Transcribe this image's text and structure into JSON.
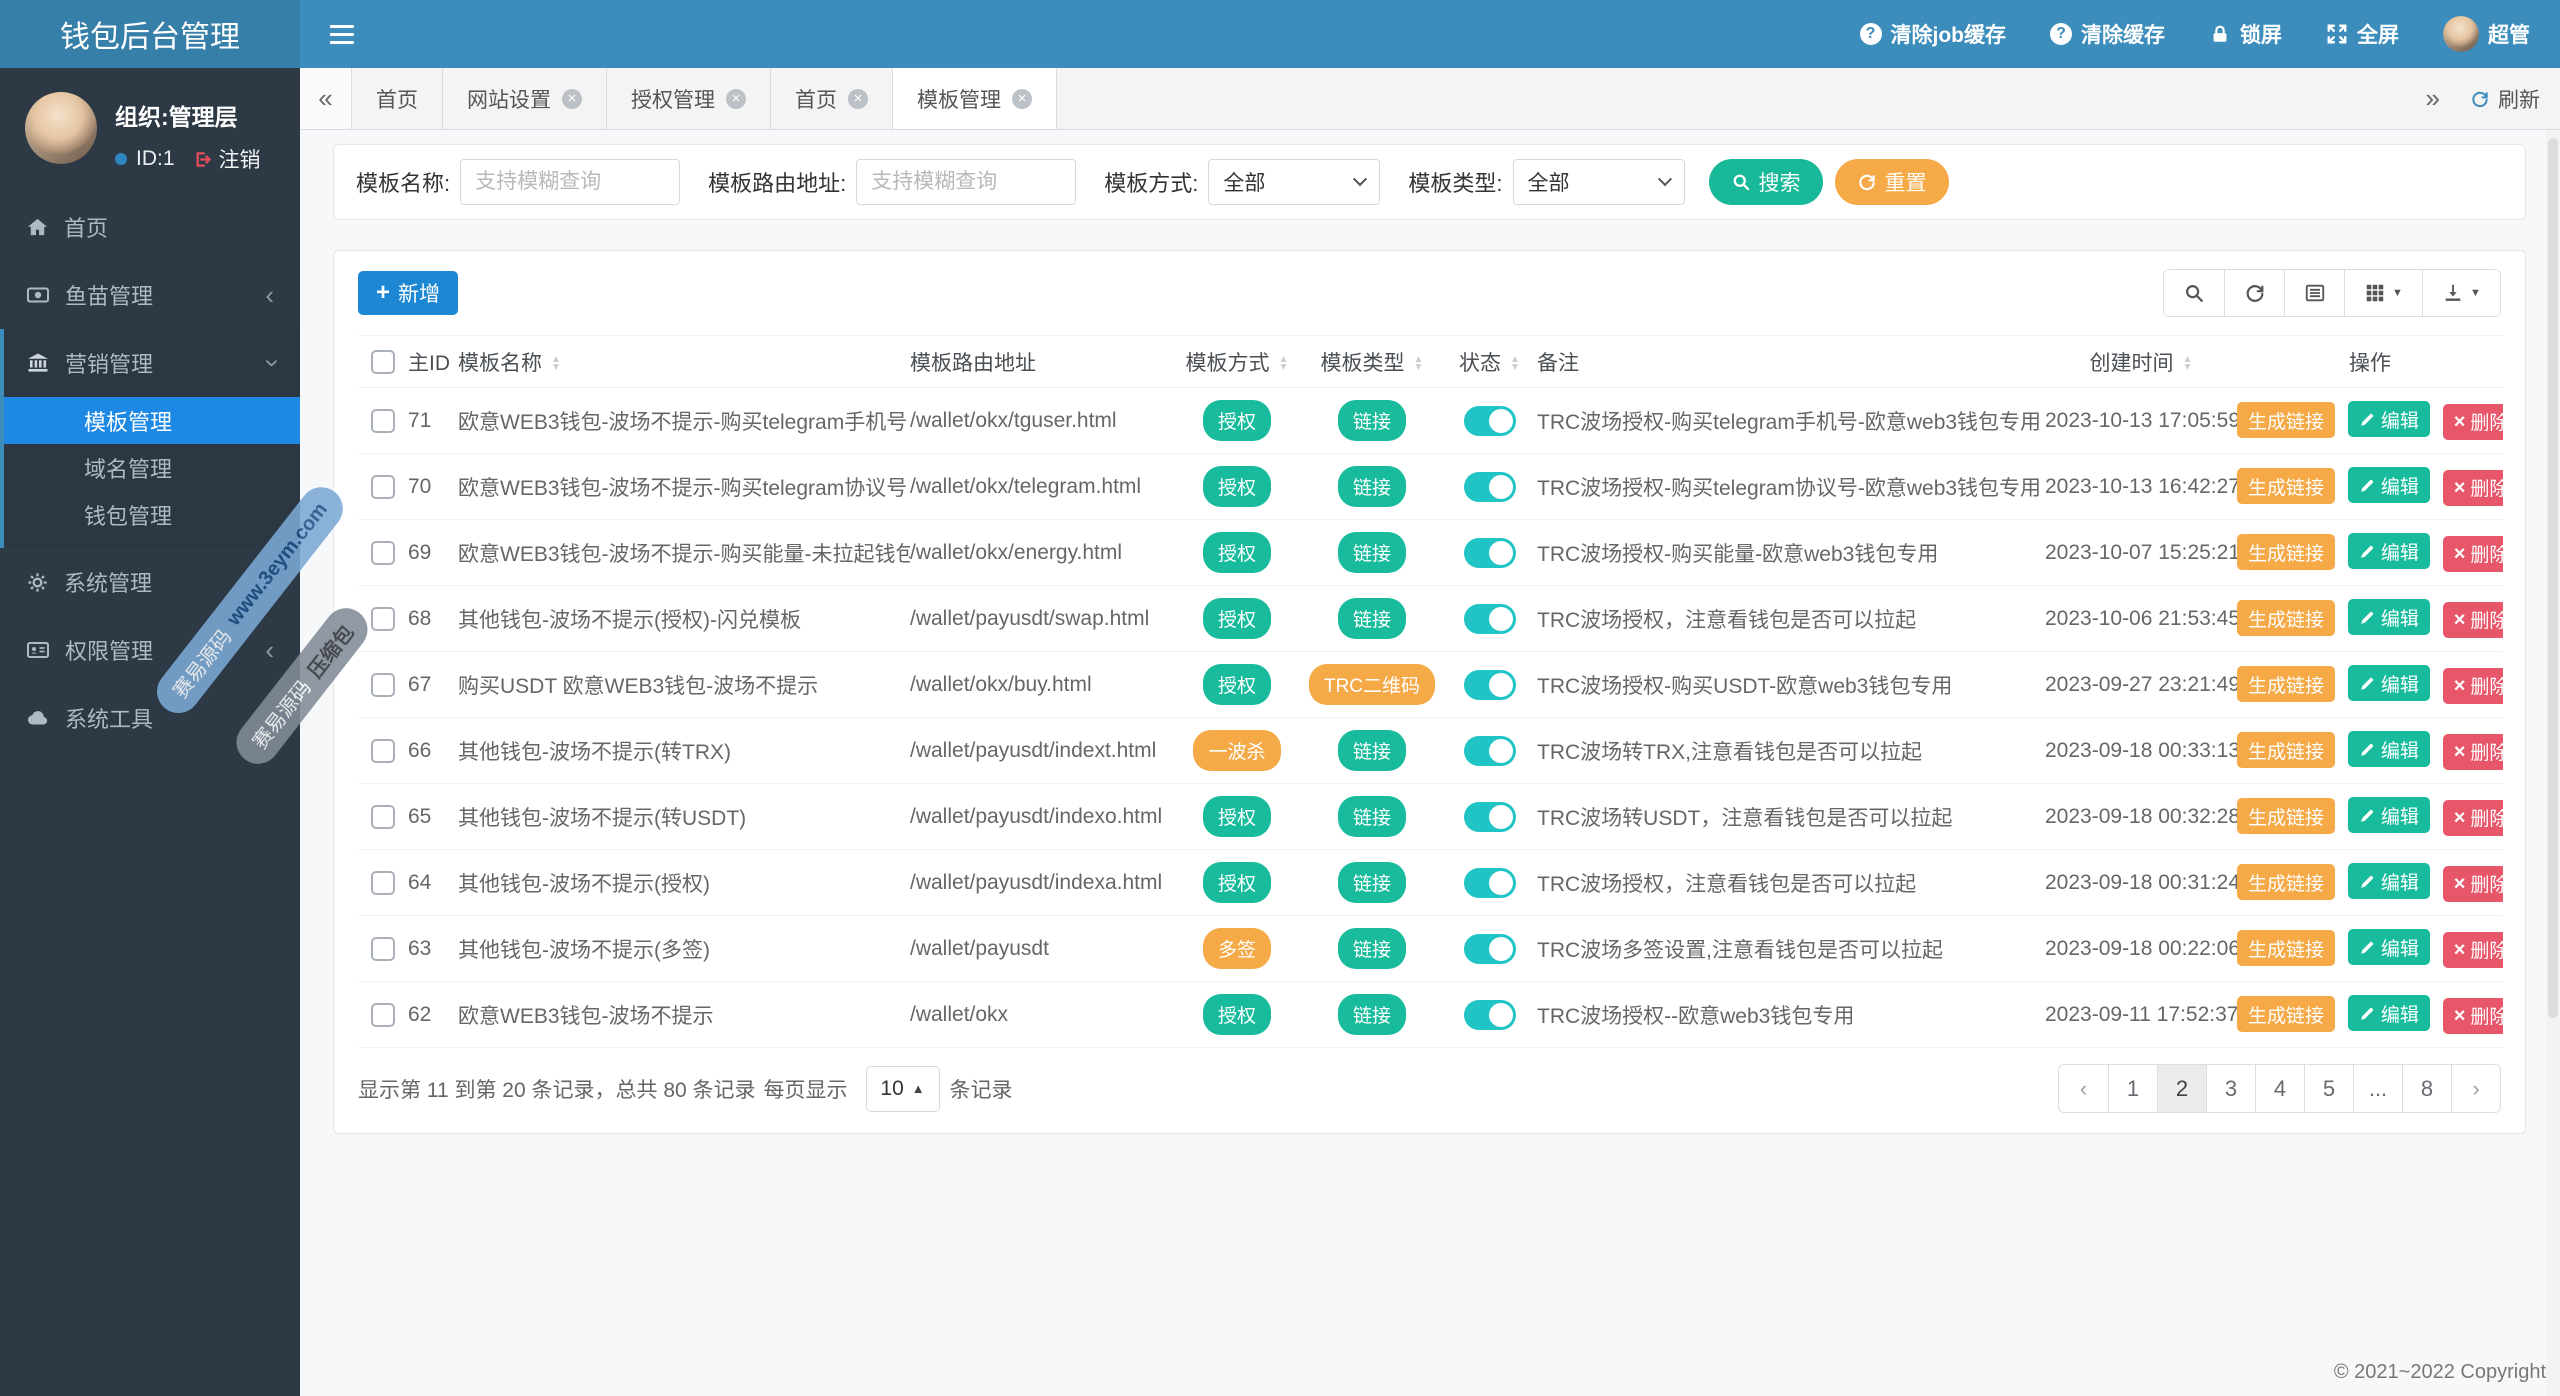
{
  "app": {
    "title": "钱包后台管理",
    "copyright": "© 2021~2022 Copyright"
  },
  "header": {
    "actions": [
      {
        "label": "清除job缓存",
        "icon": "question-circle-icon"
      },
      {
        "label": "清除缓存",
        "icon": "question-circle-icon"
      },
      {
        "label": "锁屏",
        "icon": "lock-icon"
      },
      {
        "label": "全屏",
        "icon": "fullscreen-icon"
      },
      {
        "label": "超管",
        "icon": "avatar"
      }
    ]
  },
  "sidebar": {
    "user": {
      "org": "组织:管理层",
      "id": "ID:1",
      "logout": "注销"
    },
    "menu": {
      "home": "首页",
      "fish": "鱼苗管理",
      "marketing": "营销管理",
      "marketing_children": [
        "模板管理",
        "域名管理",
        "钱包管理"
      ],
      "active_child": "模板管理",
      "system": "系统管理",
      "permission": "权限管理",
      "tools": "系统工具"
    },
    "watermarks": [
      {
        "brand": "赛易源码",
        "site": "www.3eym.com"
      },
      {
        "brand": "赛易源码",
        "site": "压缩包"
      }
    ]
  },
  "tabs": {
    "items": [
      {
        "label": "首页",
        "closable": false,
        "active": false
      },
      {
        "label": "网站设置",
        "closable": true,
        "active": false
      },
      {
        "label": "授权管理",
        "closable": true,
        "active": false
      },
      {
        "label": "首页",
        "closable": true,
        "active": false
      },
      {
        "label": "模板管理",
        "closable": true,
        "active": true
      }
    ],
    "refresh_label": "刷新"
  },
  "filters": {
    "name_label": "模板名称:",
    "name_placeholder": "支持模糊查询",
    "route_label": "模板路由地址:",
    "route_placeholder": "支持模糊查询",
    "method_label": "模板方式:",
    "method_value": "全部",
    "type_label": "模板类型:",
    "type_value": "全部",
    "search_label": "搜索",
    "reset_label": "重置"
  },
  "toolbar": {
    "add_label": "新增"
  },
  "table": {
    "columns": [
      {
        "label": "主ID",
        "sortable": false
      },
      {
        "label": "模板名称",
        "sortable": true
      },
      {
        "label": "模板路由地址",
        "sortable": false
      },
      {
        "label": "模板方式",
        "sortable": true
      },
      {
        "label": "模板类型",
        "sortable": true
      },
      {
        "label": "状态",
        "sortable": true
      },
      {
        "label": "备注",
        "sortable": false
      },
      {
        "label": "创建时间",
        "sortable": true
      },
      {
        "label": "操作",
        "sortable": false
      }
    ],
    "actions": {
      "generate": "生成链接",
      "edit": "编辑",
      "delete": "删除"
    },
    "rows": [
      {
        "id": "71",
        "name": "欧意WEB3钱包-波场不提示-购买telegram手机号",
        "route": "/wallet/okx/tguser.html",
        "method": "授权",
        "method_style": "green",
        "type": "链接",
        "type_style": "green",
        "status": "on",
        "remark": "TRC波场授权-购买telegram手机号-欧意web3钱包专用",
        "created": "2023-10-13 17:05:59"
      },
      {
        "id": "70",
        "name": "欧意WEB3钱包-波场不提示-购买telegram协议号",
        "route": "/wallet/okx/telegram.html",
        "method": "授权",
        "method_style": "green",
        "type": "链接",
        "type_style": "green",
        "status": "on",
        "remark": "TRC波场授权-购买telegram协议号-欧意web3钱包专用",
        "created": "2023-10-13 16:42:27"
      },
      {
        "id": "69",
        "name": "欧意WEB3钱包-波场不提示-购买能量-未拉起钱包",
        "route": "/wallet/okx/energy.html",
        "method": "授权",
        "method_style": "green",
        "type": "链接",
        "type_style": "green",
        "status": "on",
        "remark": "TRC波场授权-购买能量-欧意web3钱包专用",
        "created": "2023-10-07 15:25:21"
      },
      {
        "id": "68",
        "name": "其他钱包-波场不提示(授权)-闪兑模板",
        "route": "/wallet/payusdt/swap.html",
        "method": "授权",
        "method_style": "green",
        "type": "链接",
        "type_style": "green",
        "status": "on",
        "remark": "TRC波场授权，注意看钱包是否可以拉起",
        "created": "2023-10-06 21:53:45"
      },
      {
        "id": "67",
        "name": "购买USDT 欧意WEB3钱包-波场不提示",
        "route": "/wallet/okx/buy.html",
        "method": "授权",
        "method_style": "green",
        "type": "TRC二维码",
        "type_style": "orange",
        "status": "on",
        "remark": "TRC波场授权-购买USDT-欧意web3钱包专用",
        "created": "2023-09-27 23:21:49"
      },
      {
        "id": "66",
        "name": "其他钱包-波场不提示(转TRX)",
        "route": "/wallet/payusdt/indext.html",
        "method": "一波杀",
        "method_style": "orange",
        "type": "链接",
        "type_style": "green",
        "status": "on",
        "remark": "TRC波场转TRX,注意看钱包是否可以拉起",
        "created": "2023-09-18 00:33:13"
      },
      {
        "id": "65",
        "name": "其他钱包-波场不提示(转USDT)",
        "route": "/wallet/payusdt/indexo.html",
        "method": "授权",
        "method_style": "green",
        "type": "链接",
        "type_style": "green",
        "status": "on",
        "remark": "TRC波场转USDT，注意看钱包是否可以拉起",
        "created": "2023-09-18 00:32:28"
      },
      {
        "id": "64",
        "name": "其他钱包-波场不提示(授权)",
        "route": "/wallet/payusdt/indexa.html",
        "method": "授权",
        "method_style": "green",
        "type": "链接",
        "type_style": "green",
        "status": "on",
        "remark": "TRC波场授权，注意看钱包是否可以拉起",
        "created": "2023-09-18 00:31:24"
      },
      {
        "id": "63",
        "name": "其他钱包-波场不提示(多签)",
        "route": "/wallet/payusdt",
        "method": "多签",
        "method_style": "orange",
        "type": "链接",
        "type_style": "green",
        "status": "on",
        "remark": "TRC波场多签设置,注意看钱包是否可以拉起",
        "created": "2023-09-18 00:22:06"
      },
      {
        "id": "62",
        "name": "欧意WEB3钱包-波场不提示",
        "route": "/wallet/okx",
        "method": "授权",
        "method_style": "green",
        "type": "链接",
        "type_style": "green",
        "status": "on",
        "remark": "TRC波场授权--欧意web3钱包专用",
        "created": "2023-09-11 17:52:37"
      }
    ]
  },
  "pagination": {
    "info": "显示第 11 到第 20 条记录，总共 80 条记录",
    "per_page_label": "每页显示",
    "per_page_value": "10",
    "per_page_suffix": "条记录",
    "prev_label": "‹",
    "next_label": "›",
    "pages": [
      "1",
      "2",
      "3",
      "4",
      "5",
      "...",
      "8"
    ],
    "active_page": "2"
  },
  "colors": {
    "header_blue": "#3c8dbc",
    "logo_blue": "#367fa9",
    "sidebar_dark": "#2d3a46",
    "active_menu_blue": "#1e88e5",
    "badge_green": "#18bc9c",
    "badge_orange": "#f5a947",
    "delete_red": "#e8566a",
    "toggle_teal": "#20c4c4",
    "add_blue": "#1e87d3"
  }
}
